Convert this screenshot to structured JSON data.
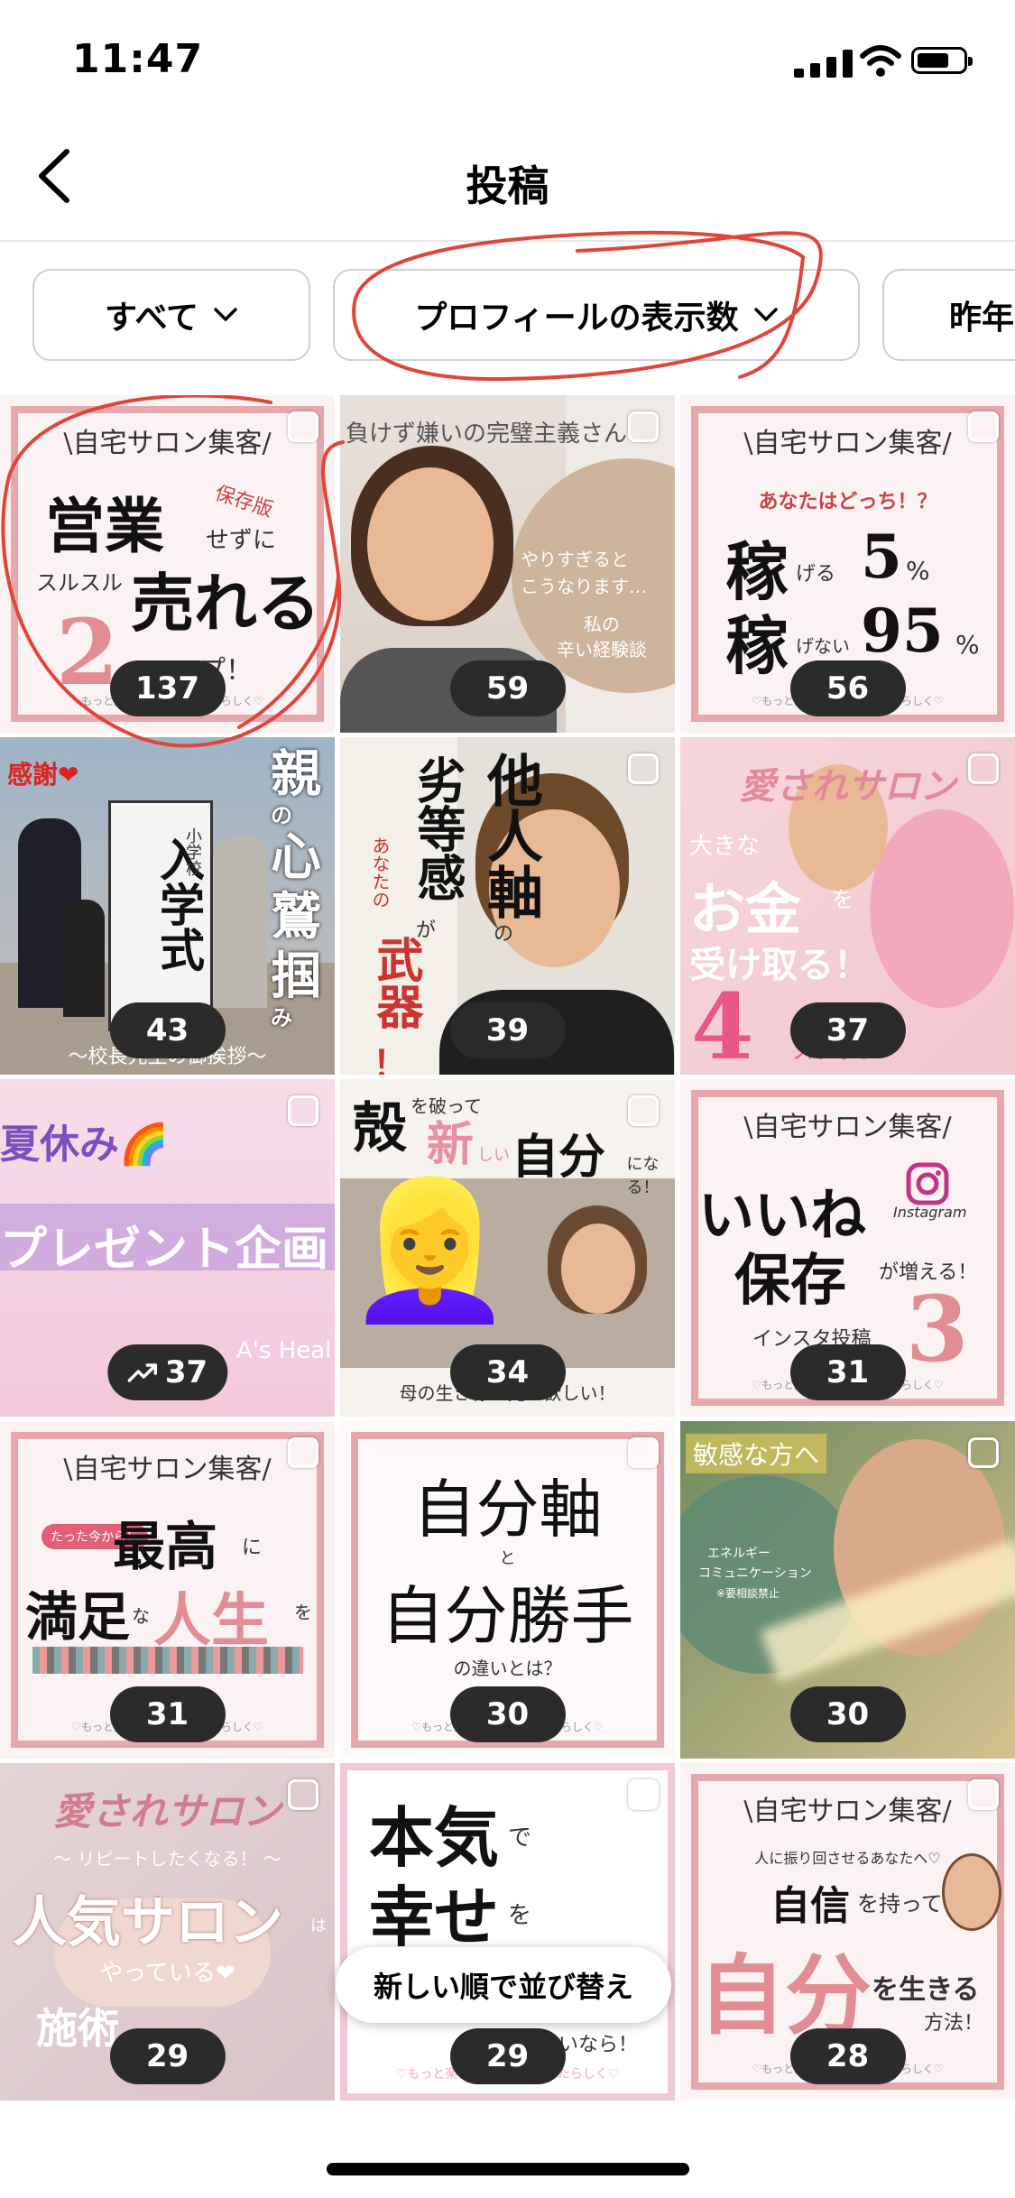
{
  "status_bar": {
    "time": "11:47"
  },
  "nav": {
    "title": "投稿"
  },
  "filters": [
    {
      "label": "すべて"
    },
    {
      "label": "プロフィールの表示数"
    },
    {
      "label": "昨年"
    }
  ],
  "colors": {
    "accent_pink": "#e6a7ad",
    "annotation_red": "#e0453a",
    "count_pill": "#2b2b2b"
  },
  "tiles": [
    {
      "count": "137",
      "lines": [
        "\\自宅サロン集客/",
        "営業",
        "保存版",
        "せずに",
        "スルスル",
        "売れる",
        "2",
        "プ！",
        "♡もっと楽しく♡もっとあなたらしく♡"
      ]
    },
    {
      "count": "59",
      "lines": [
        "負けず嫌いの完璧主義さん",
        "やりすぎると",
        "こうなります…",
        "私の",
        "辛い経験談"
      ]
    },
    {
      "count": "56",
      "lines": [
        "\\自宅サロン集客/",
        "あなたはどっち！？",
        "稼",
        "げる",
        "5",
        "%",
        "稼",
        "げない",
        "95",
        "%",
        "♡もっと楽しく♡もっとあなたらしく♡"
      ]
    },
    {
      "count": "43",
      "lines": [
        "感謝❤",
        "入学式",
        "小学校",
        "親",
        "の",
        "心",
        "鷲",
        "掴",
        "み",
        "〜校長先生の御挨拶〜"
      ]
    },
    {
      "count": "39",
      "lines": [
        "他人軸",
        "の",
        "劣等感",
        "が",
        "あなたの",
        "武器",
        "！"
      ]
    },
    {
      "count": "37",
      "lines": [
        "愛されサロン",
        "大きな",
        "お金",
        "を",
        "受け取る！",
        "4",
        "ステップ"
      ]
    },
    {
      "count": "37",
      "trending": true,
      "lines": [
        "夏休み🌈",
        "プレゼント企画",
        "A's Heal"
      ]
    },
    {
      "count": "34",
      "lines": [
        "殻",
        "を破って",
        "新",
        "しい",
        "自分",
        "になる！",
        "👱‍♀️",
        "母の生き様を見て欲しい！"
      ]
    },
    {
      "count": "31",
      "lines": [
        "\\自宅サロン集客/",
        "いいね",
        "保存",
        "が増える！",
        "3",
        "Instagram",
        "インスタ投稿",
        "♡もっと楽しく♡もっとあなたらしく♡"
      ]
    },
    {
      "count": "31",
      "lines": [
        "\\自宅サロン集客/",
        "たった今から！",
        "最高",
        "に",
        "満足",
        "な",
        "人生",
        "を",
        "♡もっと楽しく♡もっとあなたらしく♡"
      ]
    },
    {
      "count": "30",
      "lines": [
        "自分軸",
        "と",
        "自分勝手",
        "の違いとは？",
        "♡もっと楽しく♡もっとあなたらしく♡"
      ]
    },
    {
      "count": "30",
      "lines": [
        "敏感な方へ",
        "エネルギー",
        "コミュニケーション",
        "※要相談禁止"
      ]
    },
    {
      "count": "29",
      "lines": [
        "愛されサロン",
        "〜 リピートしたくなる！ 〜",
        "人気サロン",
        "は",
        "やっている❤",
        "施術"
      ]
    },
    {
      "count": "29",
      "lines": [
        "本気",
        "で",
        "幸せ",
        "を",
        "たいなら！",
        "♡もっと楽しく♡もっとあなたらしく♡"
      ]
    },
    {
      "count": "28",
      "lines": [
        "\\自宅サロン集客/",
        "人に振り回させるあなたへ♡",
        "自信",
        "を持って",
        "自分",
        "を生きる",
        "方法！",
        "♡もっと楽しく♡もっとあなたらしく♡"
      ]
    }
  ],
  "sort_tooltip": {
    "label": "新しい順で並び替え"
  }
}
